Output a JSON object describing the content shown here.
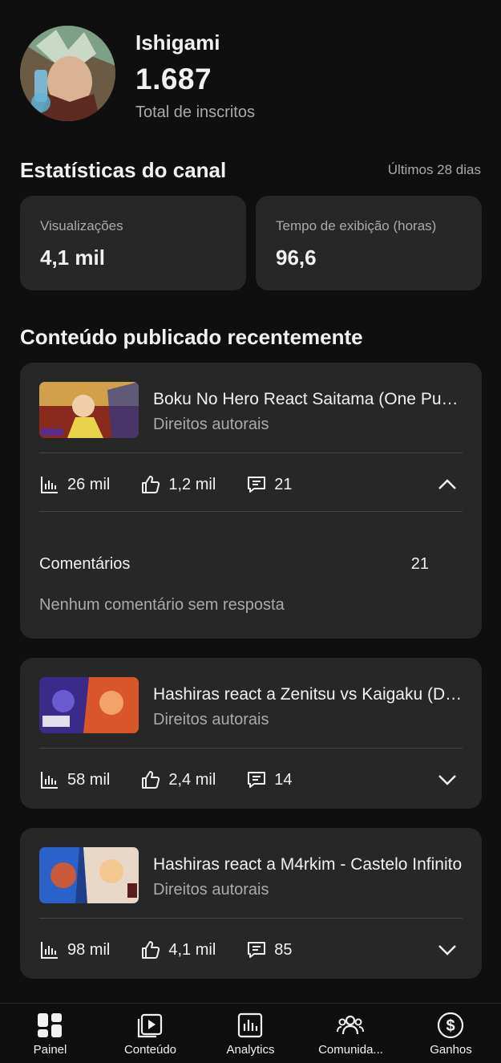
{
  "channel": {
    "name": "Ishigami",
    "subscriber_count": "1.687",
    "subscriber_label": "Total de inscritos",
    "avatar_icon": "channel-avatar"
  },
  "stats": {
    "title": "Estatísticas do canal",
    "period": "Últimos 28 dias",
    "views_label": "Visualizações",
    "views_value": "4,1 mil",
    "watch_label": "Tempo de exibição (horas)",
    "watch_value": "96,6"
  },
  "recent": {
    "title": "Conteúdo publicado recentemente",
    "videos": [
      {
        "title": "Boku No Hero React Saitama (One Punch Man)",
        "subtitle": "Direitos autorais",
        "views": "26 mil",
        "likes": "1,2 mil",
        "comments": "21",
        "expanded": true,
        "comments_label": "Comentários",
        "comments_count": "21",
        "comments_empty": "Nenhum comentário sem resposta"
      },
      {
        "title": "Hashiras react a Zenitsu vs Kaigaku  (Demon Slayer)",
        "subtitle": "Direitos autorais",
        "views": "58 mil",
        "likes": "2,4 mil",
        "comments": "14",
        "expanded": false
      },
      {
        "title": "Hashiras react a M4rkim - Castelo Infinito",
        "subtitle": "Direitos autorais",
        "views": "98 mil",
        "likes": "4,1 mil",
        "comments": "85",
        "expanded": false
      }
    ]
  },
  "nav": {
    "items": [
      {
        "label": "Painel",
        "icon": "dashboard-icon"
      },
      {
        "label": "Conteúdo",
        "icon": "content-icon"
      },
      {
        "label": "Analytics",
        "icon": "analytics-icon"
      },
      {
        "label": "Comunida...",
        "icon": "community-icon"
      },
      {
        "label": "Ganhos",
        "icon": "earnings-icon"
      }
    ]
  },
  "colors": {
    "background": "#0f0f0f",
    "card": "#272727",
    "text": "#f1f1f1",
    "secondary_text": "#aaaaaa",
    "divider": "#454545"
  }
}
